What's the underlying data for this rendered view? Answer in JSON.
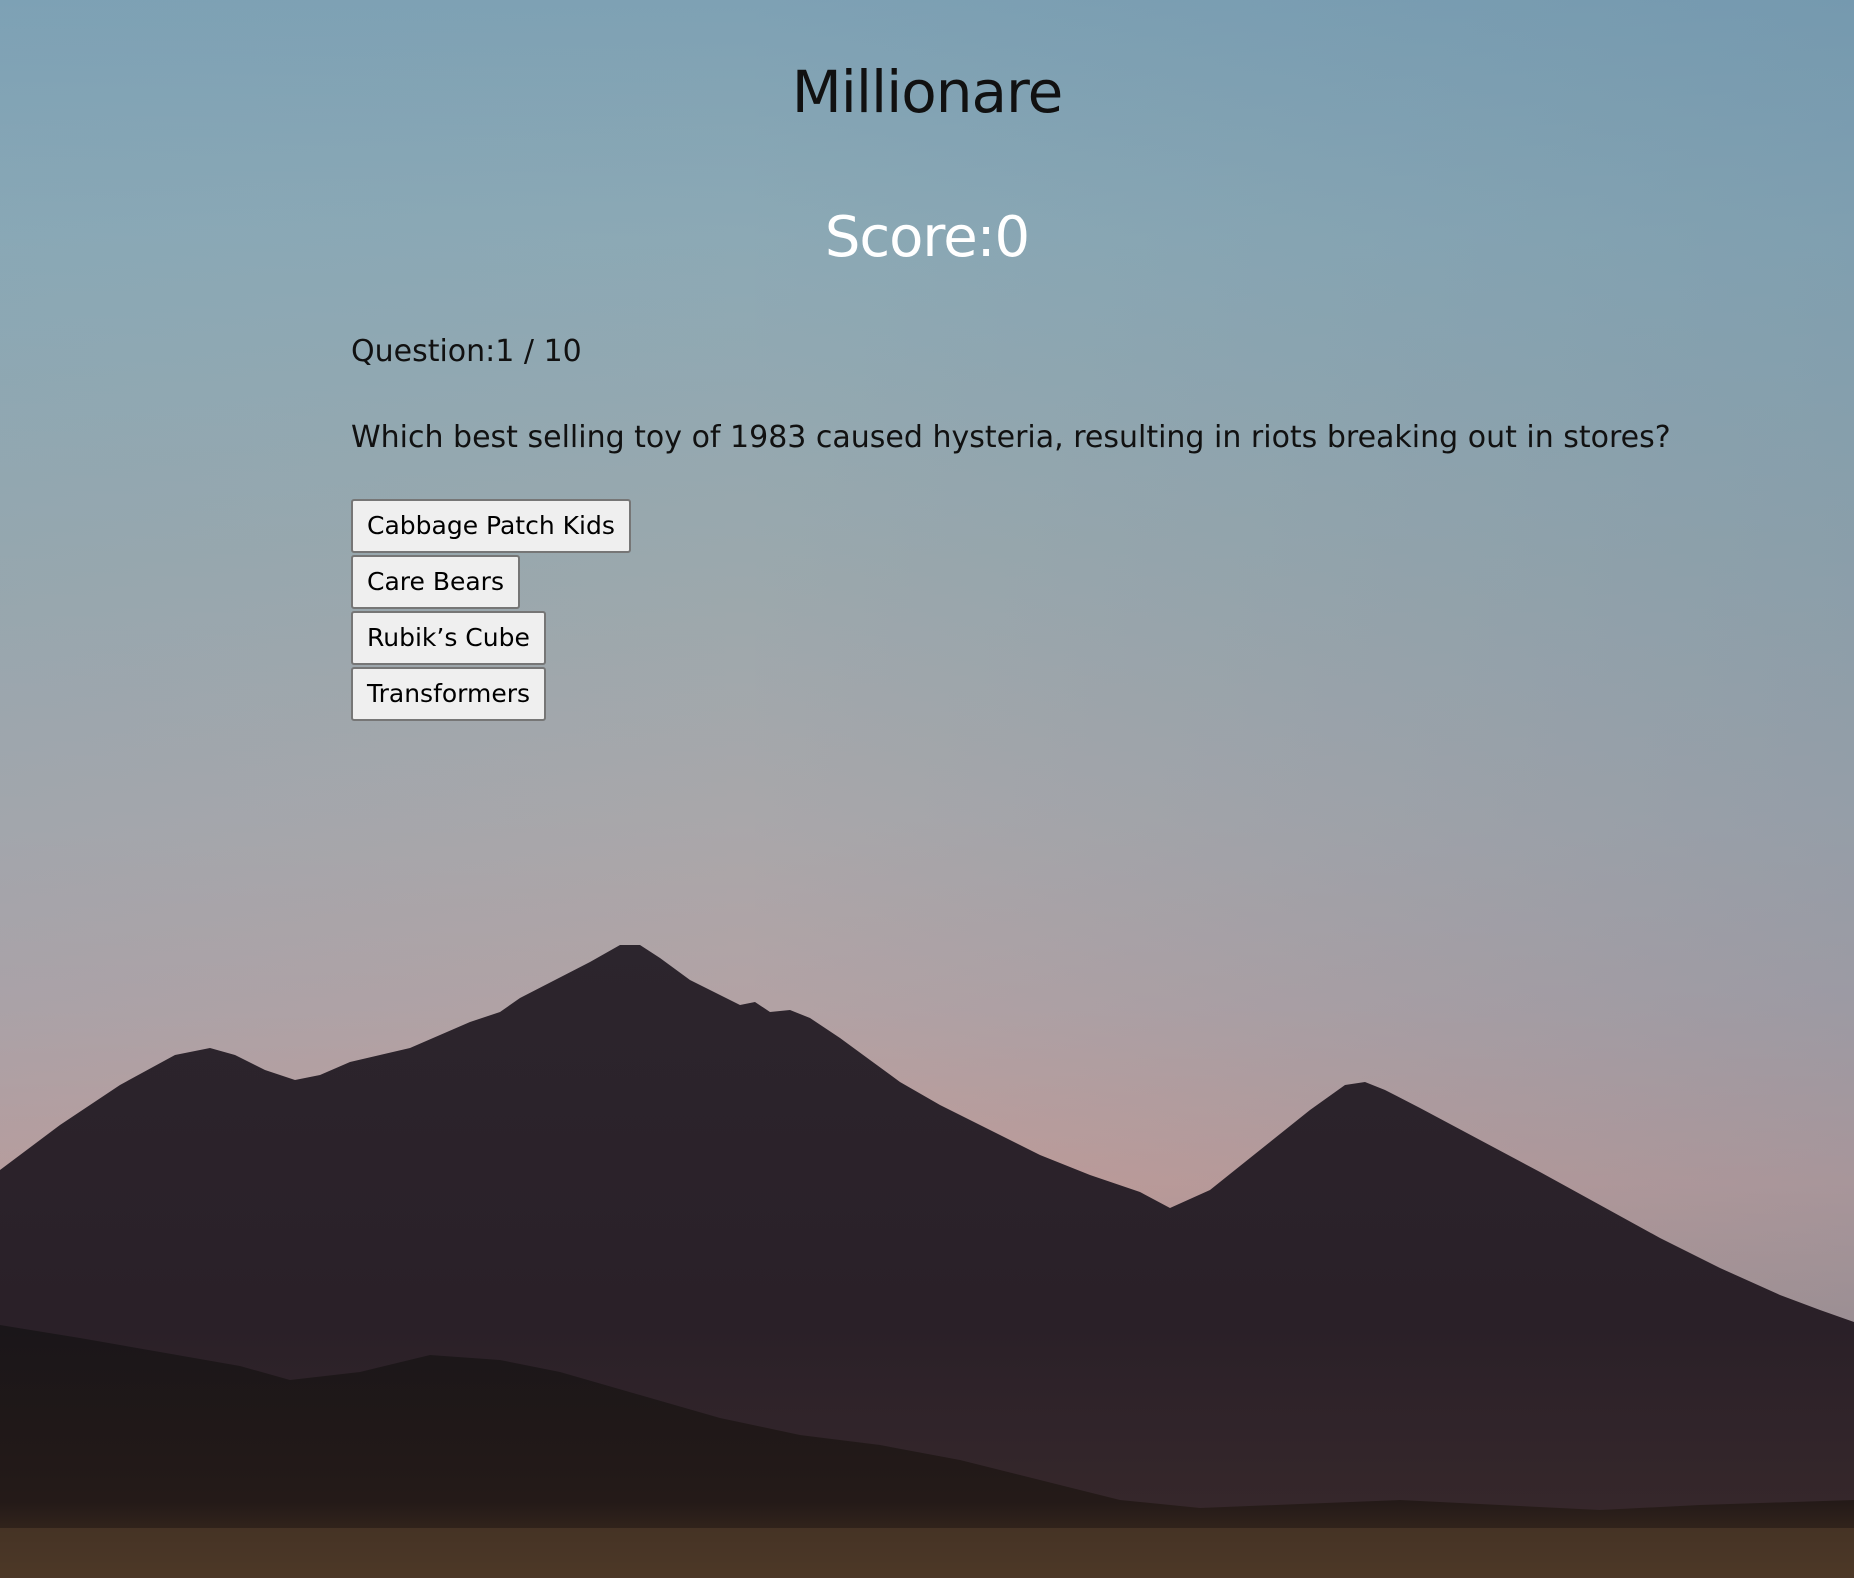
{
  "title": "Millionare",
  "score": {
    "label": "Score:",
    "value": "0"
  },
  "question": {
    "counter_label": "Question:",
    "counter": "1 / 10",
    "text": "Which best selling toy of 1983 caused hysteria, resulting in riots breaking out in stores?"
  },
  "answers": [
    {
      "label": "Cabbage Patch Kids"
    },
    {
      "label": "Care Bears"
    },
    {
      "label": "Rubik’s Cube"
    },
    {
      "label": "Transformers"
    }
  ],
  "colors": {
    "title_text": "#111111",
    "score_text": "#ffffff",
    "button_bg": "#efefef",
    "button_border": "#767676",
    "mountain": "#2a2229"
  }
}
